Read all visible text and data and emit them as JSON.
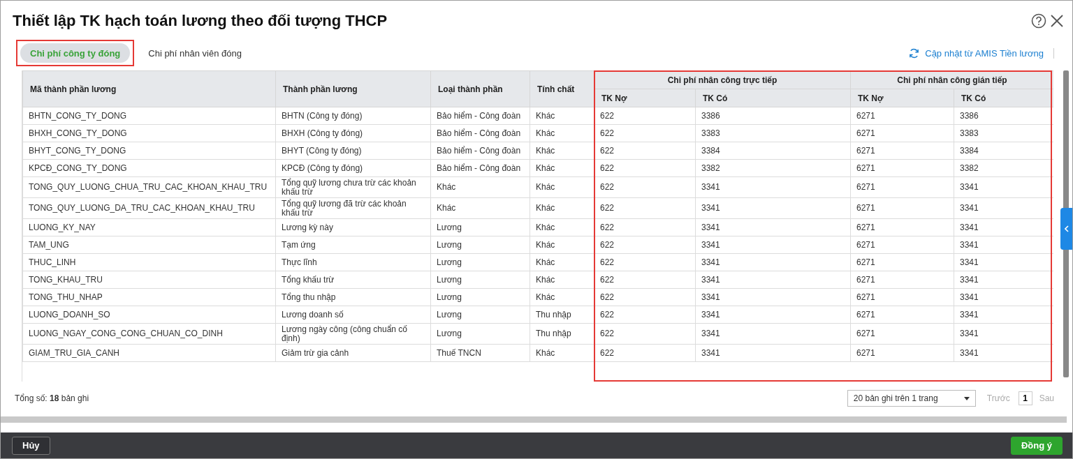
{
  "dialog": {
    "title": "Thiết lập TK hạch toán lương theo đối tượng THCP"
  },
  "tabs": [
    {
      "label": "Chi phí công ty đóng",
      "selected": true,
      "highlighted": true
    },
    {
      "label": "Chi phí nhân viên đóng",
      "selected": false,
      "highlighted": false
    }
  ],
  "sync_link": "Cập nhật từ AMIS Tiền lương",
  "table": {
    "columns": [
      "Mã thành phần lương",
      "Thành phần lương",
      "Loại thành phần",
      "Tính chất"
    ],
    "column_groups": [
      {
        "title": "Chi phí nhân công trực tiếp",
        "columns": [
          "TK Nợ",
          "TK Có"
        ],
        "highlighted": true
      },
      {
        "title": "Chi phí nhân công gián tiếp",
        "columns": [
          "TK Nợ",
          "TK Có"
        ],
        "highlighted": true
      }
    ],
    "rows": [
      [
        "BHTN_CONG_TY_DONG",
        "BHTN (Công ty đóng)",
        "Bảo hiểm - Công đoàn",
        "Khác",
        "622",
        "3386",
        "6271",
        "3386"
      ],
      [
        "BHXH_CONG_TY_DONG",
        "BHXH (Công ty đóng)",
        "Bảo hiểm - Công đoàn",
        "Khác",
        "622",
        "3383",
        "6271",
        "3383"
      ],
      [
        "BHYT_CONG_TY_DONG",
        "BHYT (Công ty đóng)",
        "Bảo hiểm - Công đoàn",
        "Khác",
        "622",
        "3384",
        "6271",
        "3384"
      ],
      [
        "KPCĐ_CONG_TY_DONG",
        "KPCĐ (Công ty đóng)",
        "Bảo hiểm - Công đoàn",
        "Khác",
        "622",
        "3382",
        "6271",
        "3382"
      ],
      [
        "TONG_QUY_LUONG_CHUA_TRU_CAC_KHOAN_KHAU_TRU",
        "Tổng quỹ lương chưa trừ các khoản khấu trừ",
        "Khác",
        "Khác",
        "622",
        "3341",
        "6271",
        "3341"
      ],
      [
        "TONG_QUY_LUONG_DA_TRU_CAC_KHOAN_KHAU_TRU",
        "Tổng quỹ lương đã trừ các khoản khấu trừ",
        "Khác",
        "Khác",
        "622",
        "3341",
        "6271",
        "3341"
      ],
      [
        "LUONG_KY_NAY",
        "Lương kỳ này",
        "Lương",
        "Khác",
        "622",
        "3341",
        "6271",
        "3341"
      ],
      [
        "TAM_UNG",
        "Tạm ứng",
        "Lương",
        "Khác",
        "622",
        "3341",
        "6271",
        "3341"
      ],
      [
        "THUC_LINH",
        "Thực lĩnh",
        "Lương",
        "Khác",
        "622",
        "3341",
        "6271",
        "3341"
      ],
      [
        "TONG_KHAU_TRU",
        "Tổng khấu trừ",
        "Lương",
        "Khác",
        "622",
        "3341",
        "6271",
        "3341"
      ],
      [
        "TONG_THU_NHAP",
        "Tổng thu nhập",
        "Lương",
        "Khác",
        "622",
        "3341",
        "6271",
        "3341"
      ],
      [
        "LUONG_DOANH_SO",
        "Lương doanh số",
        "Lương",
        "Thu nhập",
        "622",
        "3341",
        "6271",
        "3341"
      ],
      [
        "LUONG_NGAY_CONG_CONG_CHUAN_CO_DINH",
        "Lương ngày công (công chuẩn cố định)",
        "Lương",
        "Thu nhập",
        "622",
        "3341",
        "6271",
        "3341"
      ],
      [
        "GIAM_TRU_GIA_CANH",
        "Giảm trừ gia cảnh",
        "Thuế TNCN",
        "Khác",
        "622",
        "3341",
        "6271",
        "3341"
      ]
    ]
  },
  "footer": {
    "total": "Tổng số: **18** bản ghi",
    "page_size": "20 bản ghi trên 1 trang",
    "prev": "Trước",
    "page": "1",
    "next": "Sau"
  },
  "buttons": {
    "cancel": "Hủy",
    "ok": "Đồng ý"
  }
}
